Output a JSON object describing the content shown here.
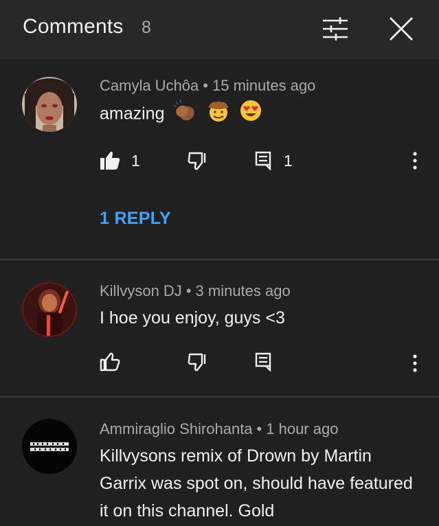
{
  "header": {
    "title": "Comments",
    "count": "8"
  },
  "comments": [
    {
      "author": "Camyla Uchôa",
      "time": "15 minutes ago",
      "text": "amazing",
      "emojis": [
        "clapping-hands-emoji",
        "cowboy-hat-face-emoji",
        "heart-eyes-emoji"
      ],
      "likes": "1",
      "replies": "1",
      "liked": true,
      "reply_link": "1 REPLY"
    },
    {
      "author": "Killvyson DJ",
      "time": "3 minutes ago",
      "text": "I hoe you enjoy, guys <3",
      "likes": "",
      "replies": "",
      "liked": false
    },
    {
      "author": "Ammiraglio Shirohanta",
      "time": "1 hour ago",
      "text": "Killvysons remix of Drown by Martin Garrix was spot on, should have featured it on this channel. Gold"
    }
  ],
  "colors": {
    "background": "#202020",
    "header": "#282828",
    "link": "#3ea6ff",
    "secondary_text": "#aaaaaa"
  },
  "icons": {
    "sort": "sliders-icon",
    "close": "close-icon",
    "like": "thumbs-up-icon",
    "dislike": "thumbs-down-icon",
    "reply": "reply-icon",
    "more": "more-vert-icon"
  }
}
